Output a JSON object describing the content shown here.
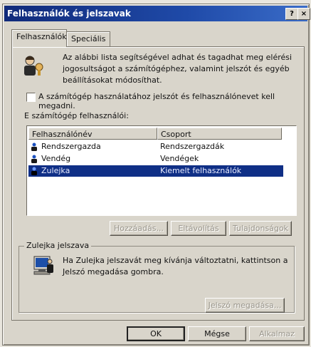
{
  "window": {
    "title": "Felhasználók és jelszavak",
    "help_label": "?",
    "close_label": "×"
  },
  "tabs": [
    {
      "label": "Felhasználók",
      "active": true
    },
    {
      "label": "Speciális",
      "active": false
    }
  ],
  "intro": {
    "line1": "Az alábbi lista segítségével adhat és tagadhat meg elérési",
    "line2": "jogosultságot a számítógéphez, valamint jelszót és egyéb",
    "line3": "beállításokat módosíthat."
  },
  "require_login_checkbox": {
    "label": "A számítógép használatához jelszót és felhasználónevet kell megadni.",
    "checked": false
  },
  "users_list": {
    "label": "E számítógép felhasználói:",
    "columns": [
      "Felhasználónév",
      "Csoport"
    ],
    "rows": [
      {
        "name": "Rendszergazda",
        "group": "Rendszergazdák",
        "selected": false
      },
      {
        "name": "Vendég",
        "group": "Vendégek",
        "selected": false
      },
      {
        "name": "Zulejka",
        "group": "Kiemelt felhasználók",
        "selected": true
      }
    ]
  },
  "list_buttons": {
    "add": "Hozzáadás...",
    "remove": "Eltávolítás",
    "properties": "Tulajdonságok"
  },
  "password_group": {
    "title": "Zulejka jelszava",
    "line1": "Ha Zulejka jelszavát meg kívánja változtatni, kattintson a",
    "line2": "Jelszó megadása gombra.",
    "button": "Jelszó megadása..."
  },
  "footer_buttons": {
    "ok": "OK",
    "cancel": "Mégse",
    "apply": "Alkalmaz"
  },
  "colors": {
    "titlebar": "#1f4aa8",
    "selection": "#0f2f86",
    "face": "#d9d5cb"
  }
}
